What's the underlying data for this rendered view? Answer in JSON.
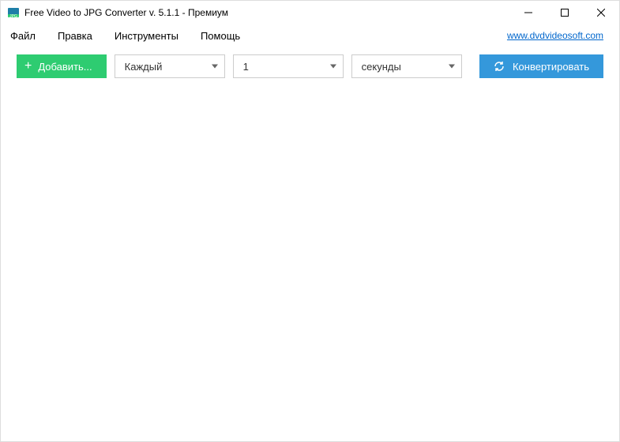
{
  "title": "Free Video to JPG Converter v. 5.1.1 - Премиум",
  "menu": {
    "file": "Файл",
    "edit": "Правка",
    "tools": "Инструменты",
    "help": "Помощь",
    "link": "www.dvdvideosoft.com"
  },
  "toolbar": {
    "add_label": "Добавить...",
    "select_mode": "Каждый",
    "select_count": "1",
    "select_unit": "секунды",
    "convert_label": "Конвертировать"
  }
}
